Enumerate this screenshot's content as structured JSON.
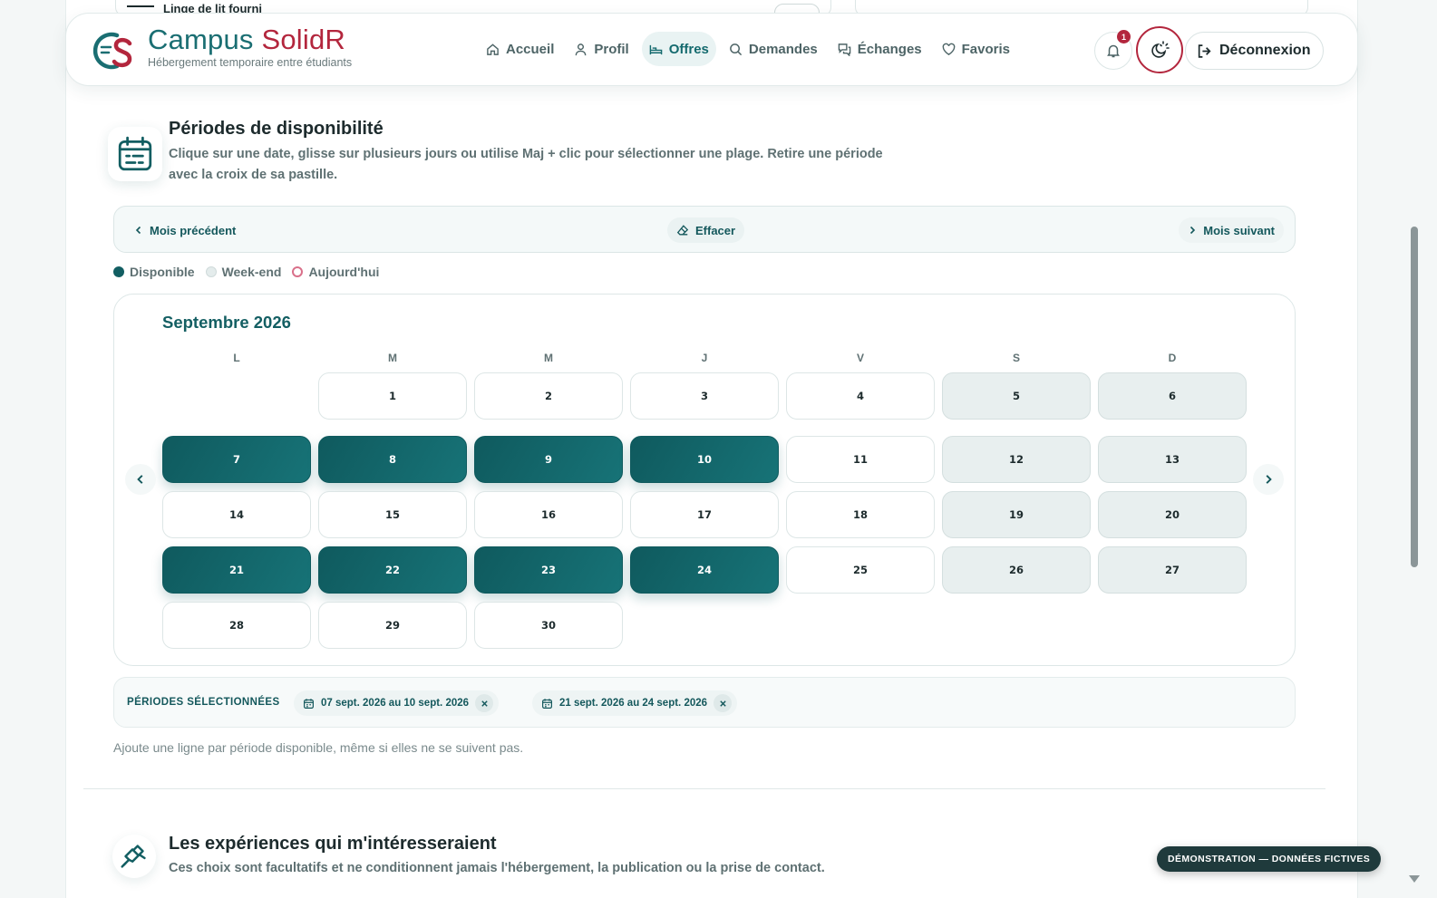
{
  "colors": {
    "primary": "#125e62",
    "accent": "#b3263d",
    "weekend": "#e8efef"
  },
  "peek": {
    "left_text": "Linge de lit fourni"
  },
  "brand": {
    "title_part1": "Campus ",
    "title_part2": "SolidR",
    "subtitle": "Hébergement temporaire entre étudiants"
  },
  "nav": [
    {
      "label": "Accueil",
      "icon": "home-icon"
    },
    {
      "label": "Profil",
      "icon": "user-icon"
    },
    {
      "label": "Offres",
      "icon": "bed-icon",
      "active": true
    },
    {
      "label": "Demandes",
      "icon": "search-icon"
    },
    {
      "label": "Échanges",
      "icon": "chat-icon"
    },
    {
      "label": "Favoris",
      "icon": "heart-icon"
    }
  ],
  "notifications": {
    "count": "1"
  },
  "logout": {
    "label": "Déconnexion"
  },
  "availability": {
    "title": "Périodes de disponibilité",
    "description": "Clique sur une date, glisse sur plusieurs jours ou utilise Maj + clic pour sélectionner une plage. Retire une période avec la croix de sa pastille.",
    "toolbar": {
      "prev": "Mois précédent",
      "clear": "Effacer",
      "next": "Mois suivant"
    },
    "legend": {
      "available": "Disponible",
      "weekend": "Week-end",
      "today": "Aujourd'hui"
    },
    "month": "Septembre 2026",
    "weekdays": [
      "L",
      "M",
      "M",
      "J",
      "V",
      "S",
      "D"
    ],
    "days": [
      "1",
      "2",
      "3",
      "4",
      "5",
      "6",
      "7",
      "8",
      "9",
      "10",
      "11",
      "12",
      "13",
      "14",
      "15",
      "16",
      "17",
      "18",
      "19",
      "20",
      "21",
      "22",
      "23",
      "24",
      "25",
      "26",
      "27",
      "28",
      "29",
      "30"
    ],
    "first_weekday_index": 1,
    "selected_days": [
      7,
      8,
      9,
      10,
      21,
      22,
      23,
      24
    ],
    "periods_label": "PÉRIODES SÉLECTIONNÉES",
    "periods": [
      "07 sept. 2026 au 10 sept. 2026",
      "21 sept. 2026 au 24 sept. 2026"
    ],
    "hint": "Ajoute une ligne par période disponible, même si elles ne se suivent pas."
  },
  "experiences": {
    "title": "Les expériences qui m'intéresseraient",
    "description": "Ces choix sont facultatifs et ne conditionnent jamais l'hébergement, la publication ou la prise de contact."
  },
  "demo_badge": "DÉMONSTRATION — DONNÉES FICTIVES"
}
